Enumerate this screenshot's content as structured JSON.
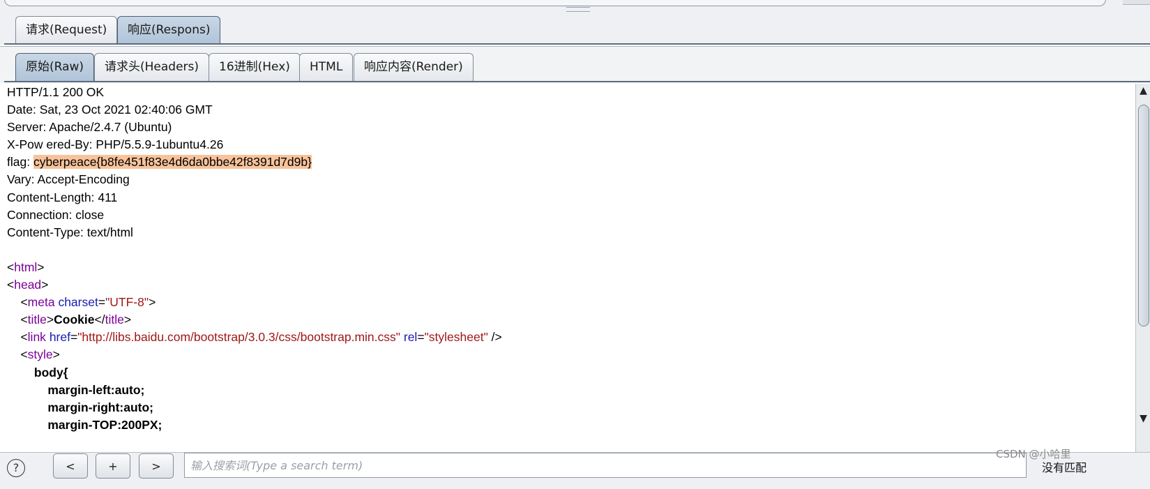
{
  "main_tabs": [
    {
      "label": "请求(Request)",
      "active": false
    },
    {
      "label": "响应(Respons)",
      "active": true
    }
  ],
  "sub_tabs": [
    {
      "label": "原始(Raw)",
      "active": true
    },
    {
      "label": "请求头(Headers)",
      "active": false
    },
    {
      "label": "16进制(Hex)",
      "active": false
    },
    {
      "label": "HTML",
      "active": false
    },
    {
      "label": "响应内容(Render)",
      "active": false
    }
  ],
  "response": {
    "status_line": "HTTP/1.1 200 OK",
    "date": "Date: Sat, 23 Oct 2021 02:40:06 GMT",
    "server": "Server: Apache/2.4.7 (Ubuntu)",
    "powered_by": "X-Pow ered-By: PHP/5.5.9-1ubuntu4.26",
    "flag_key": "flag: ",
    "flag_value": "cyberpeace{b8fe451f83e4d6da0bbe42f8391d7d9b}",
    "vary": "Vary: Accept-Encoding",
    "content_length": "Content-Length: 411",
    "connection": "Connection: close",
    "content_type": "Content-Type: text/html",
    "html_tag": "html",
    "head_tag": "head",
    "meta_tag": "meta",
    "meta_attr": "charset",
    "meta_val": "\"UTF-8\"",
    "title_tag": "title",
    "title_text": "Cookie",
    "link_tag": "link",
    "link_href_attr": "href",
    "link_href_val": "\"http://libs.baidu.com/bootstrap/3.0.3/css/bootstrap.min.css\"",
    "link_rel_attr": "rel",
    "link_rel_val": "\"stylesheet\"",
    "style_tag": "style",
    "css_body": "body{",
    "css_margin_left": "margin-left:auto;",
    "css_margin_right": "margin-right:auto;",
    "css_margin_top": "margin-TOP:200PX;"
  },
  "bottom_bar": {
    "help_label": "?",
    "prev_label": "<",
    "add_label": "+",
    "next_label": ">",
    "search_placeholder": "输入搜索词(Type a search term)",
    "no_match": "没有匹配"
  },
  "watermark": "CSDN @小哈里",
  "icons": {
    "scroll_up": "up-arrow-icon",
    "scroll_down": "down-arrow-icon",
    "help": "help-circle-icon"
  },
  "colors": {
    "flag_highlight": "#f8c39b",
    "tag": "#7b0098",
    "attr": "#1b1bb0",
    "value": "#a01818",
    "active_tab": "#afc3d8"
  }
}
